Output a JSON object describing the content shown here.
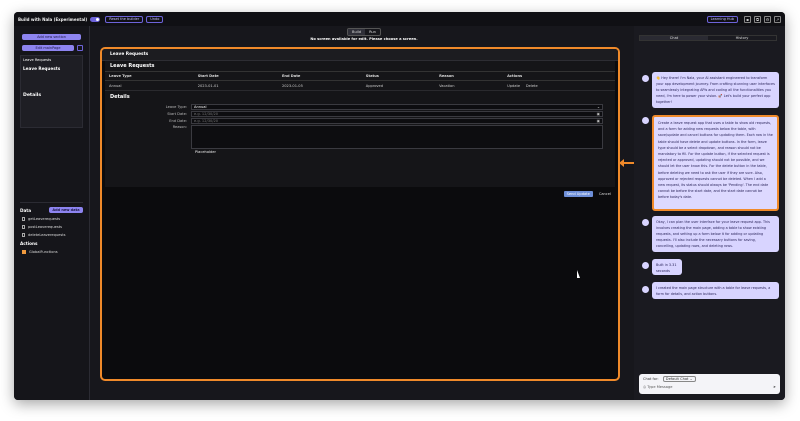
{
  "topbar": {
    "title": "Build with Nala (Experimental)",
    "reset_label": "Reset the builder",
    "undo_label": "Undo",
    "learning_hub": "Learning Hub"
  },
  "left": {
    "add_section": "Add new section",
    "edit_mainpage": "Edit mainPage",
    "tree_item": "Leave Requests",
    "tree_sub": "Leave Requests",
    "tree_details": "Details",
    "data_title": "Data",
    "add_data": "Add new data",
    "data_items": [
      "getLeaverequests",
      "postLeaverequests",
      "deleteLeaverequests"
    ],
    "actions_title": "Actions",
    "action_items": [
      "GlobalFunctions"
    ]
  },
  "center": {
    "build_label": "Build",
    "run_label": "Run",
    "no_screen": "No screen available for edit. Please choose a screen."
  },
  "app": {
    "header": "Leave Requests",
    "section_title": "Leave Requests",
    "columns": [
      "Leave Type",
      "Start Date",
      "End Date",
      "Status",
      "Reason",
      "Actions"
    ],
    "rows": [
      {
        "type": "Annual",
        "start": "2023-01-01",
        "end": "2023-01-05",
        "status": "Approved",
        "reason": "Vacation",
        "update": "Update",
        "delete": "Delete"
      }
    ],
    "details_title": "Details",
    "form": {
      "leave_type_label": "Leave Type:",
      "leave_type_value": "Annual",
      "start_label": "Start Date:",
      "start_ph": "e.g. 12/30/20",
      "end_label": "End Date:",
      "end_ph": "e.g. 12/30/20",
      "reason_label": "Reason:",
      "placeholder": "Placeholder",
      "submit": "Send Update",
      "cancel": "Cancel"
    }
  },
  "right": {
    "tabs": [
      "Chat",
      "History"
    ],
    "messages": [
      "👋 Hey there! I'm Nala, your AI assistant engineered to transform your app development journey. From crafting stunning user interfaces to seamlessly integrating APIs and coding all the functionalities you need, I'm here to power your vision. 🚀 Let's build your perfect app together!",
      "Create a leave request app that uses a table to show old requests, and a form for adding new requests below the table, with save/update and cancel buttons for updating them. Each row in the table should have delete and update buttons. In the form, leave type should be a select dropdown, and reason should not be mandatory to fill. For the update button, if the selected request is rejected or approved, updating should not be possible, and we should let the user know this. For the delete button in the table, before deleting we need to ask the user if they are sure. Also, approved or rejected requests cannot be deleted. When I add a new request, its status should always be 'Pending'. The end date cannot be before the start date, and the start date cannot be before today's date.",
      "Okay, I can plan the user interface for your leave request app. This involves creating the main page, adding a table to show existing requests, and setting up a form below it for adding or updating requests. I'll also include the necessary buttons for saving, cancelling, updating rows, and deleting rows.",
      "Built in 3.31 seconds",
      "I created the main page structure with a table for leave requests, a form for details, and action buttons."
    ],
    "chat_for": "Chat for:",
    "chat_select": "Default Chat",
    "input_ph": "Type Message"
  }
}
